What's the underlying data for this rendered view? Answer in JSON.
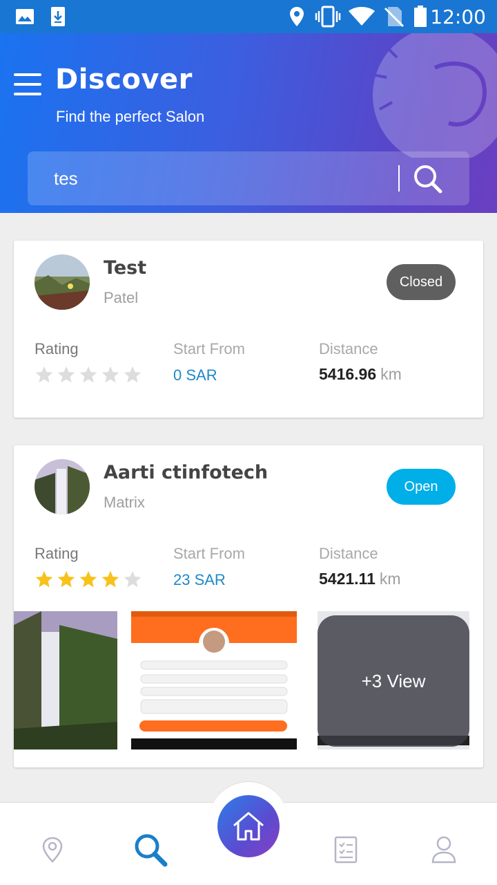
{
  "status_bar": {
    "time": "12:00",
    "icons": [
      "image-icon",
      "download-icon",
      "location-icon",
      "vibrate-icon",
      "wifi-icon",
      "no-sim-icon",
      "battery-icon"
    ]
  },
  "header": {
    "title": "Discover",
    "subtitle": "Find the perfect Salon",
    "search_value": "tes"
  },
  "salons": [
    {
      "name": "Test",
      "subtitle": "Patel",
      "status": "Closed",
      "rating_label": "Rating",
      "rating": 0,
      "price_label": "Start From",
      "price": "0 SAR",
      "distance_label": "Distance",
      "distance": "5416.96",
      "distance_unit": "km"
    },
    {
      "name": "Aarti ctinfotech",
      "subtitle": "Matrix",
      "status": "Open",
      "rating_label": "Rating",
      "rating": 4,
      "price_label": "Start From",
      "price": "23 SAR",
      "distance_label": "Distance",
      "distance": "5421.11",
      "distance_unit": "km",
      "more_label": "+3 View"
    }
  ],
  "colors": {
    "accent": "#1a73f0",
    "closed": "#5f5f5f",
    "open": "#00aee8",
    "price": "#1e88c8",
    "star_on": "#f7c21b",
    "star_off": "#dddddd",
    "nav_active": "#1a7fc8"
  },
  "bottom_nav": {
    "items": [
      "map-pin-icon",
      "search-icon",
      "home-icon",
      "bookings-icon",
      "profile-icon"
    ],
    "active": "search-icon"
  }
}
